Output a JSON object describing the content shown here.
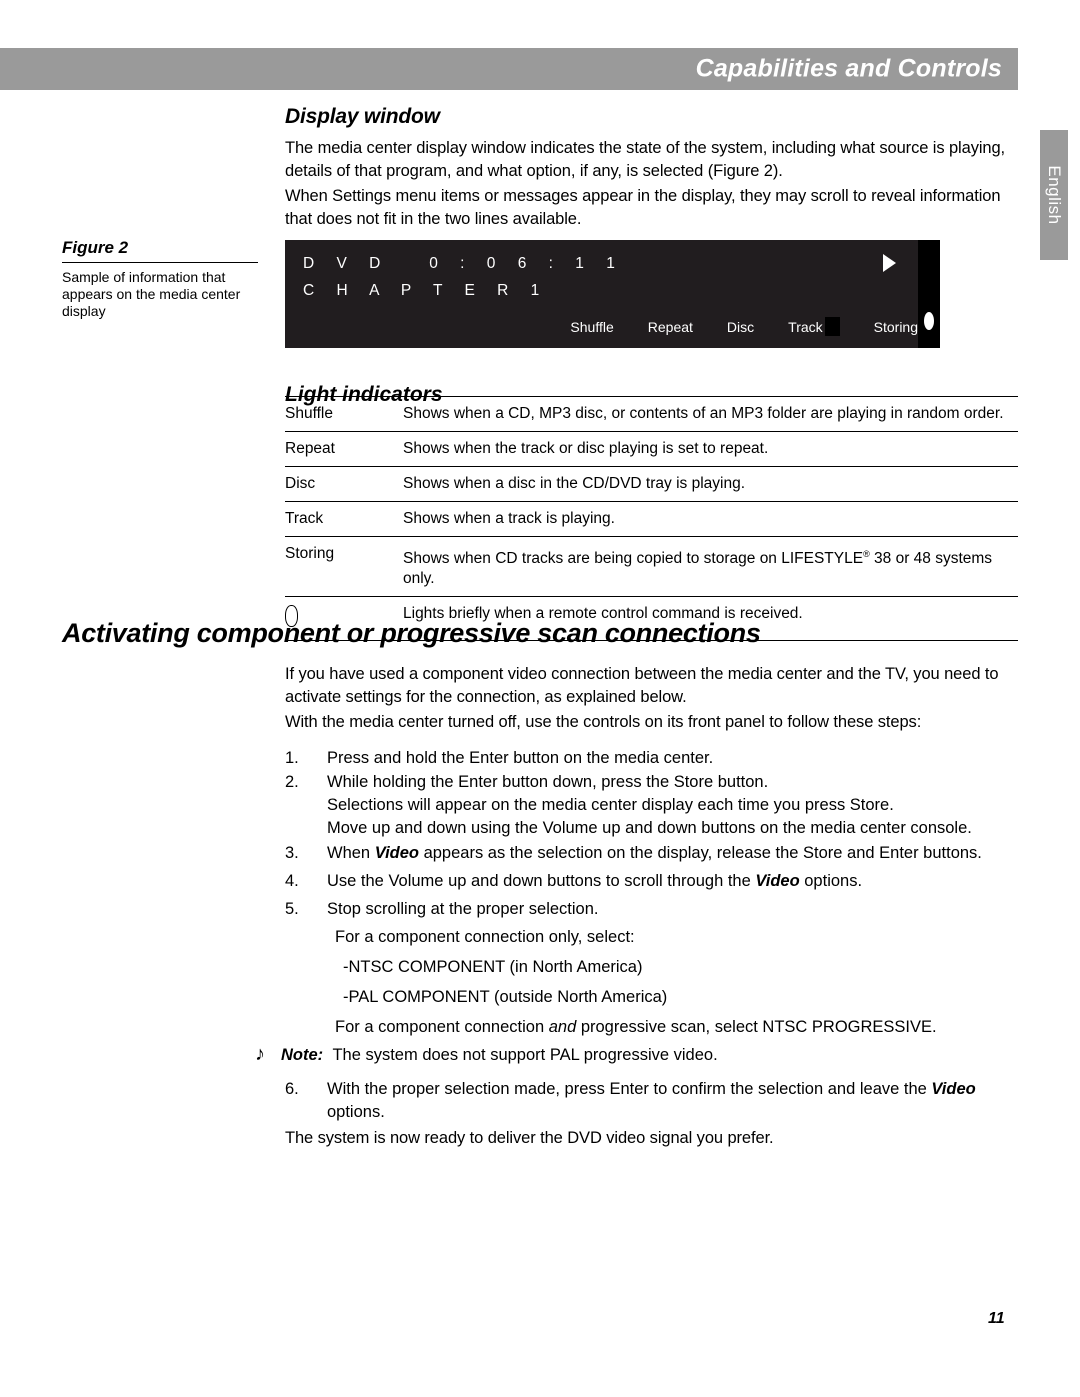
{
  "header": {
    "title": "Capabilities and Controls",
    "bar_color": "#9a9a9a"
  },
  "language_tab": {
    "label": "English"
  },
  "sections": {
    "display_window": {
      "title": "Display window",
      "paragraphs": [
        "The media center display window indicates the state of the system, including what source is playing, details of that program, and what option, if any, is selected (Figure 2).",
        "When Settings menu items or messages appear in the display, they may scroll to reveal information that does not fit in the two lines available."
      ]
    },
    "light_indicators": {
      "title": "Light indicators"
    },
    "activating": {
      "title": "Activating component or progressive scan connections",
      "intro_paragraphs": [
        "If you have used a component video connection between the media center and the TV, you need to activate settings for the connection, as explained below.",
        "With the media center turned off, use the controls on its front panel to follow these steps:"
      ],
      "closing_paragraph": "The system is now ready to deliver the DVD video signal you prefer."
    }
  },
  "figure": {
    "label": "Figure 2",
    "caption": "Sample of information that appears on the media center display"
  },
  "display_graphic": {
    "line1": "D V D   0 : 0 6 : 1 1",
    "line2": "C H A P T E R 1",
    "play_arrow_icon": "play-arrow",
    "remote_oval_icon": "remote-oval",
    "indicators": [
      "Shuffle",
      "Repeat",
      "Disc",
      "Track",
      "Storing"
    ],
    "background_color": "#211d1f",
    "strip_color": "#000000",
    "text_color": "#ffffff"
  },
  "light_indicator_rows": [
    {
      "name": "Shuffle",
      "is_icon": false,
      "description": "Shows when a CD, MP3 disc, or contents of an MP3 folder are playing in random order."
    },
    {
      "name": "Repeat",
      "is_icon": false,
      "description": "Shows when the track or disc playing is set to repeat."
    },
    {
      "name": "Disc",
      "is_icon": false,
      "description": "Shows when a disc in the CD/DVD tray is playing."
    },
    {
      "name": "Track",
      "is_icon": false,
      "description": "Shows when a track is playing."
    },
    {
      "name": "Storing",
      "is_icon": false,
      "description_before": "Shows when CD tracks are being copied to storage on LIFESTYLE",
      "description_mark": "®",
      "description_after": " 38 or 48 systems only."
    },
    {
      "name": "",
      "is_icon": true,
      "icon": "remote-oval-icon",
      "description": "Lights briefly when a remote control command is received."
    }
  ],
  "steps": [
    {
      "number": "1.",
      "text": "Press and hold the Enter button on the media center."
    },
    {
      "number": "2.",
      "text": "While holding the Enter button down, press the Store button.",
      "extra_lines": [
        "Selections will appear on the media center display each time you press Store.",
        "Move up and down using the Volume up and down buttons on the media center console."
      ]
    },
    {
      "number": "3.",
      "pre": "When ",
      "emph": "Video",
      "post": " appears as the selection on the display, release the Store and Enter buttons."
    },
    {
      "number": "4.",
      "pre": "Use the Volume up and down buttons to scroll through the  ",
      "emph": "Video",
      "post": " options."
    },
    {
      "number": "5.",
      "text": "Stop scrolling at the proper selection.",
      "sub_lines": [
        "For a component connection only, select:",
        "-NTSC COMPONENT (in North America)",
        "-PAL COMPONENT (outside North America)"
      ]
    }
  ],
  "progressive_line": {
    "pre": "For a component connection  ",
    "emph_italic": "and",
    "post": " progressive scan, select NTSC PROGRESSIVE."
  },
  "note": {
    "icon": "music-note-icon",
    "glyph": "♪",
    "label": "Note:",
    "text": " The system does not support PAL progressive video."
  },
  "step6": {
    "number": "6.",
    "pre": "With the proper selection made, press Enter to confirm the selection and leave the  ",
    "emph": "Video",
    "post": "",
    "second_line": "options."
  },
  "page_number": "11"
}
